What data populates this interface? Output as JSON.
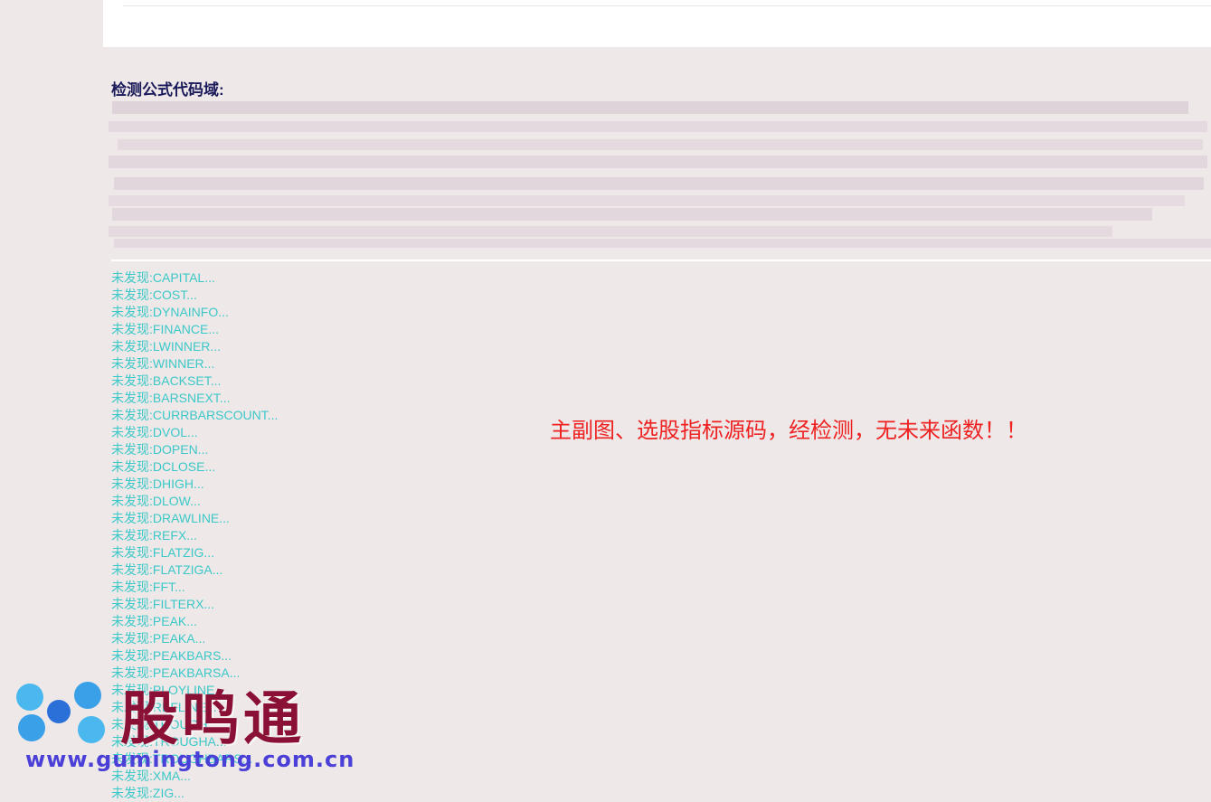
{
  "section": {
    "title": "检测公式代码域:"
  },
  "results": [
    "未发现:CAPITAL...",
    "未发现:COST...",
    "未发现:DYNAINFO...",
    "未发现:FINANCE...",
    "未发现:LWINNER...",
    "未发现:WINNER...",
    "未发现:BACKSET...",
    "未发现:BARSNEXT...",
    "未发现:CURRBARSCOUNT...",
    "未发现:DVOL...",
    "未发现:DOPEN...",
    "未发现:DCLOSE...",
    "未发现:DHIGH...",
    "未发现:DLOW...",
    "未发现:DRAWLINE...",
    "未发现:REFX...",
    "未发现:FLATZIG...",
    "未发现:FLATZIGA...",
    "未发现:FFT...",
    "未发现:FILTERX...",
    "未发现:PEAK...",
    "未发现:PEAKA...",
    "未发现:PEAKBARS...",
    "未发现:PEAKBARSA...",
    "未发现:PLOYLINE...",
    "未发现:REFLINE...",
    "未发现:TROUGH...",
    "未发现:TROUGHA...",
    "未发现:TROUGHBARS...",
    "未发现:XMA...",
    "未发现:ZIG..."
  ],
  "verdict": "主副图、选股指标源码，经检测，无未来函数！！",
  "watermark": {
    "brand": "股鸣通",
    "url": "www.gumingtong.com.cn"
  },
  "colors": {
    "background": "#efe8e8",
    "title": "#1a1a5a",
    "result_text": "#3cc8c8",
    "verdict_text": "#ee2222",
    "brand": "#8a1036",
    "url": "#4a3fd6"
  }
}
